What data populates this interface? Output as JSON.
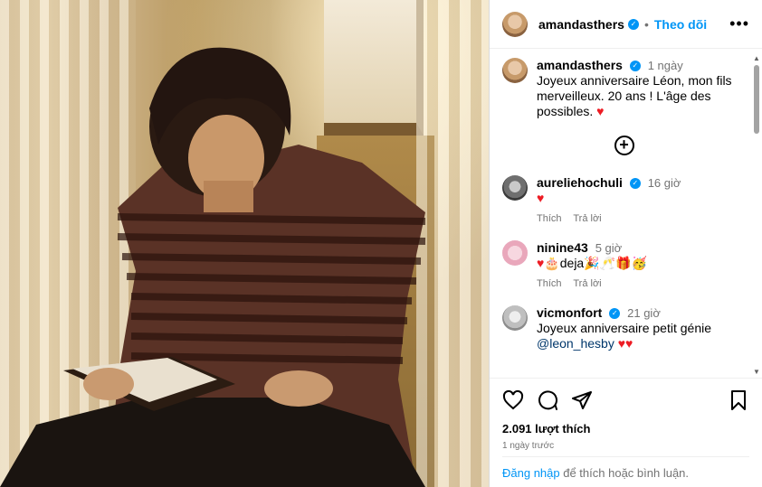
{
  "header": {
    "username": "amandasthers",
    "follow_label": "Theo dõi"
  },
  "caption": {
    "username": "amandasthers",
    "time": "1 ngày",
    "text": "Joyeux anniversaire Léon, mon fils merveilleux. 20 ans ! L'âge des possibles."
  },
  "comments": [
    {
      "username": "aureliehochuli",
      "verified": true,
      "time": "16 giờ",
      "text": "",
      "reply_label": "Trả lời",
      "like_label": "Thích"
    },
    {
      "username": "ninine43",
      "verified": false,
      "time": "5 giờ",
      "text": "deja",
      "reply_label": "Trả lời",
      "like_label": "Thích"
    },
    {
      "username": "vicmonfort",
      "verified": true,
      "time": "21 giờ",
      "text": "Joyeux anniversaire petit génie",
      "mention": "@leon_hesby"
    }
  ],
  "footer": {
    "likes": "2.091 lượt thích",
    "date": "1 ngày trước",
    "login_link": "Đăng nhập",
    "login_text": " để thích hoặc bình luận."
  },
  "colors": {
    "accent": "#0095f6",
    "heart": "#ed1c24",
    "muted": "#737373"
  }
}
